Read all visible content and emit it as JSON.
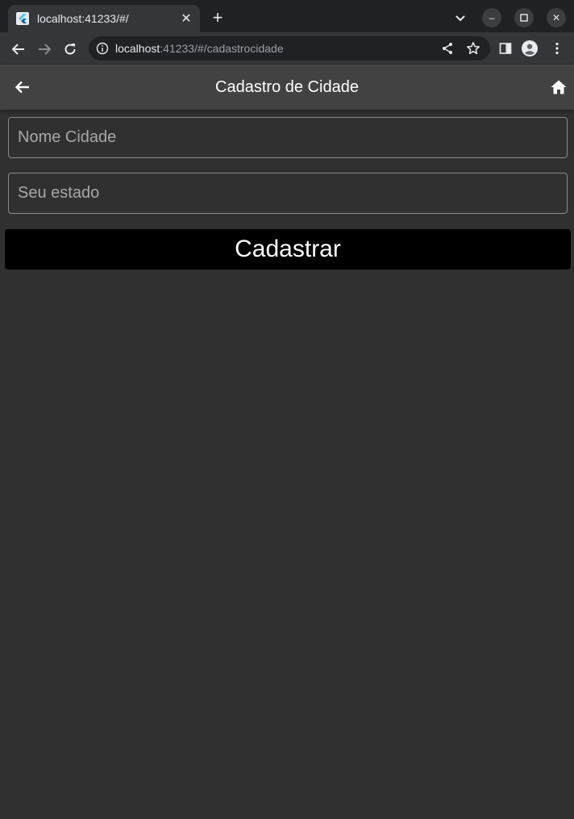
{
  "browser": {
    "tab": {
      "title": "localhost:41233/#/"
    },
    "url": {
      "host": "localhost",
      "rest": ":41233/#/cadastrocidade"
    }
  },
  "appbar": {
    "title": "Cadastro de Cidade"
  },
  "form": {
    "city_field": {
      "placeholder": "Nome Cidade",
      "value": ""
    },
    "state_field": {
      "placeholder": "Seu estado",
      "value": ""
    },
    "submit_label": "Cadastrar"
  },
  "icons": {
    "back": "arrow-left-icon",
    "home": "home-icon"
  },
  "colors": {
    "background": "#303030",
    "appbar": "#424242",
    "button": "#000000"
  }
}
